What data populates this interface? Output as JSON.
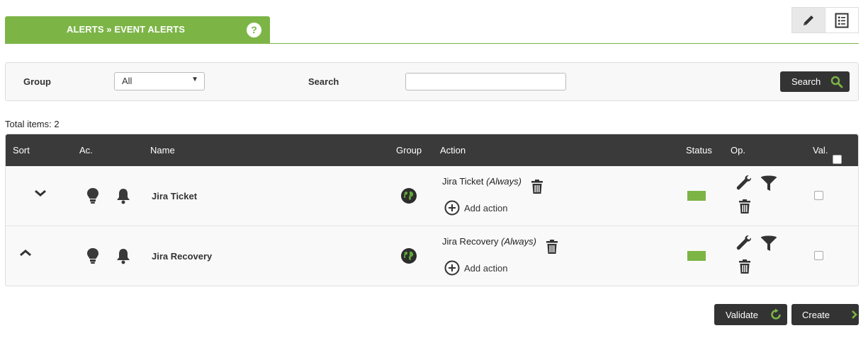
{
  "header": {
    "title": "ALERTS » EVENT ALERTS",
    "help_glyph": "?"
  },
  "top_icons": [
    "pencil-icon",
    "list-icon"
  ],
  "filter": {
    "group_label": "Group",
    "group_value": "All",
    "search_label": "Search",
    "search_value": "",
    "search_button": "Search"
  },
  "total_label": "Total items: 2",
  "table": {
    "columns": {
      "sort": "Sort",
      "ac": "Ac.",
      "name": "Name",
      "group": "Group",
      "action": "Action",
      "status": "Status",
      "op": "Op.",
      "val": "Val."
    },
    "rows": [
      {
        "sort": "down",
        "name": "Jira Ticket",
        "action": "Jira Ticket",
        "action_mode": "(Always)",
        "add_action": "Add action",
        "status_color": "#7cb546"
      },
      {
        "sort": "up",
        "name": "Jira Recovery",
        "action": "Jira Recovery",
        "action_mode": "(Always)",
        "add_action": "Add action",
        "status_color": "#7cb546"
      }
    ]
  },
  "buttons": {
    "validate": "Validate",
    "create": "Create"
  },
  "colors": {
    "accent": "#7cb546",
    "dark": "#333333"
  }
}
